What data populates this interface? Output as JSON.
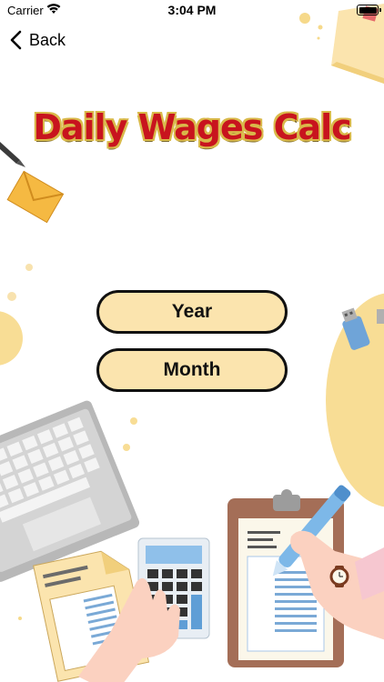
{
  "status_bar": {
    "carrier": "Carrier",
    "time": "3:04 PM",
    "wifi_icon": "wifi-icon",
    "battery_icon": "battery-icon"
  },
  "nav": {
    "back_label": "Back",
    "back_icon": "chevron-left-icon"
  },
  "title": "Daily Wages Calc",
  "buttons": {
    "year_label": "Year",
    "month_label": "Month"
  },
  "colors": {
    "button_fill": "#fbe4ae",
    "title_red": "#c8141e",
    "title_outline": "#d9b94a",
    "accent_yellow": "#f8dd95"
  },
  "decor_icons": [
    "sticky-note-icon",
    "pencil-icon",
    "envelope-icon",
    "usb-drive-icon",
    "keyboard-icon",
    "document-icon",
    "calculator-icon",
    "clipboard-icon",
    "pen-icon",
    "hand-icon",
    "wristwatch-icon"
  ]
}
